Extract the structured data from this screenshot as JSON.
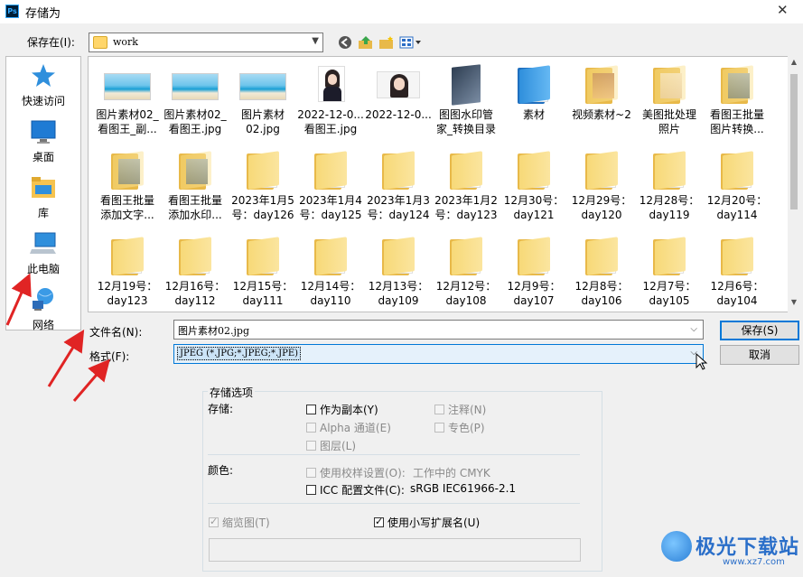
{
  "window": {
    "title": "存储为",
    "app_badge": "Ps"
  },
  "save_in": {
    "label": "保存在(I):",
    "path": "work"
  },
  "places": [
    {
      "label": "快速访问",
      "icon": "star-icon"
    },
    {
      "label": "桌面",
      "icon": "desktop-icon"
    },
    {
      "label": "库",
      "icon": "library-icon"
    },
    {
      "label": "此电脑",
      "icon": "computer-icon"
    },
    {
      "label": "网络",
      "icon": "network-icon"
    }
  ],
  "files": [
    {
      "line1": "图片素材02_",
      "line2": "看图王_副...",
      "type": "sea"
    },
    {
      "line1": "图片素材02_",
      "line2": "看图王.jpg",
      "type": "sea"
    },
    {
      "line1": "图片素材",
      "line2": "02.jpg",
      "type": "sea"
    },
    {
      "line1": "2022-12-0...",
      "line2": "看图王.jpg",
      "type": "portrait"
    },
    {
      "line1": "2022-12-0...",
      "line2": "",
      "type": "wide"
    },
    {
      "line1": "图图水印管",
      "line2": "家_转换目录",
      "type": "book"
    },
    {
      "line1": "素材",
      "line2": "",
      "type": "folder-blue"
    },
    {
      "line1": "视频素材~2",
      "line2": "",
      "type": "folder-warm"
    },
    {
      "line1": "美图批处理",
      "line2": "照片",
      "type": "folder-girl"
    },
    {
      "line1": "看图王批量",
      "line2": "图片转换...",
      "type": "folder-city"
    },
    {
      "line1": "看图王批量",
      "line2": "添加文字...",
      "type": "folder-city"
    },
    {
      "line1": "看图王批量",
      "line2": "添加水印...",
      "type": "folder-city"
    },
    {
      "line1": "2023年1月5",
      "line2": "号：day126",
      "type": "folder"
    },
    {
      "line1": "2023年1月4",
      "line2": "号：day125",
      "type": "folder"
    },
    {
      "line1": "2023年1月3",
      "line2": "号：day124",
      "type": "folder"
    },
    {
      "line1": "2023年1月2",
      "line2": "号：day123",
      "type": "folder"
    },
    {
      "line1": "12月30号：",
      "line2": "day121",
      "type": "folder"
    },
    {
      "line1": "12月29号：",
      "line2": "day120",
      "type": "folder"
    },
    {
      "line1": "12月28号：",
      "line2": "day119",
      "type": "folder"
    },
    {
      "line1": "12月20号：",
      "line2": "day114",
      "type": "folder"
    },
    {
      "line1": "12月19号：",
      "line2": "day123",
      "type": "folder"
    },
    {
      "line1": "12月16号：",
      "line2": "day112",
      "type": "folder"
    },
    {
      "line1": "12月15号：",
      "line2": "day111",
      "type": "folder"
    },
    {
      "line1": "12月14号：",
      "line2": "day110",
      "type": "folder"
    },
    {
      "line1": "12月13号：",
      "line2": "day109",
      "type": "folder"
    },
    {
      "line1": "12月12号：",
      "line2": "day108",
      "type": "folder"
    },
    {
      "line1": "12月9号：",
      "line2": "day107",
      "type": "folder"
    },
    {
      "line1": "12月8号：",
      "line2": "day106",
      "type": "folder"
    },
    {
      "line1": "12月7号：",
      "line2": "day105",
      "type": "folder"
    },
    {
      "line1": "12月6号：",
      "line2": "day104",
      "type": "folder"
    }
  ],
  "filename": {
    "label": "文件名(N):",
    "value": "图片素材02.jpg"
  },
  "format": {
    "label": "格式(F):",
    "value": "JPEG (*.JPG;*.JPEG;*.JPE)"
  },
  "buttons": {
    "save": "保存(S)",
    "cancel": "取消"
  },
  "options": {
    "group_title": "存储选项",
    "storage_label": "存储:",
    "as_copy": "作为副本(Y)",
    "notes": "注释(N)",
    "alpha": "Alpha 通道(E)",
    "spot": "专色(P)",
    "layers": "图层(L)",
    "color_label": "颜色:",
    "use_proof": "使用校样设置(O):",
    "proof_value": "工作中的 CMYK",
    "icc": "ICC 配置文件(C):",
    "icc_value": "sRGB IEC61966-2.1",
    "thumbnail": "缩览图(T)",
    "lowercase_ext": "使用小写扩展名(U)"
  },
  "watermark": {
    "name": "极光下载站",
    "url": "www.xz7.com"
  }
}
